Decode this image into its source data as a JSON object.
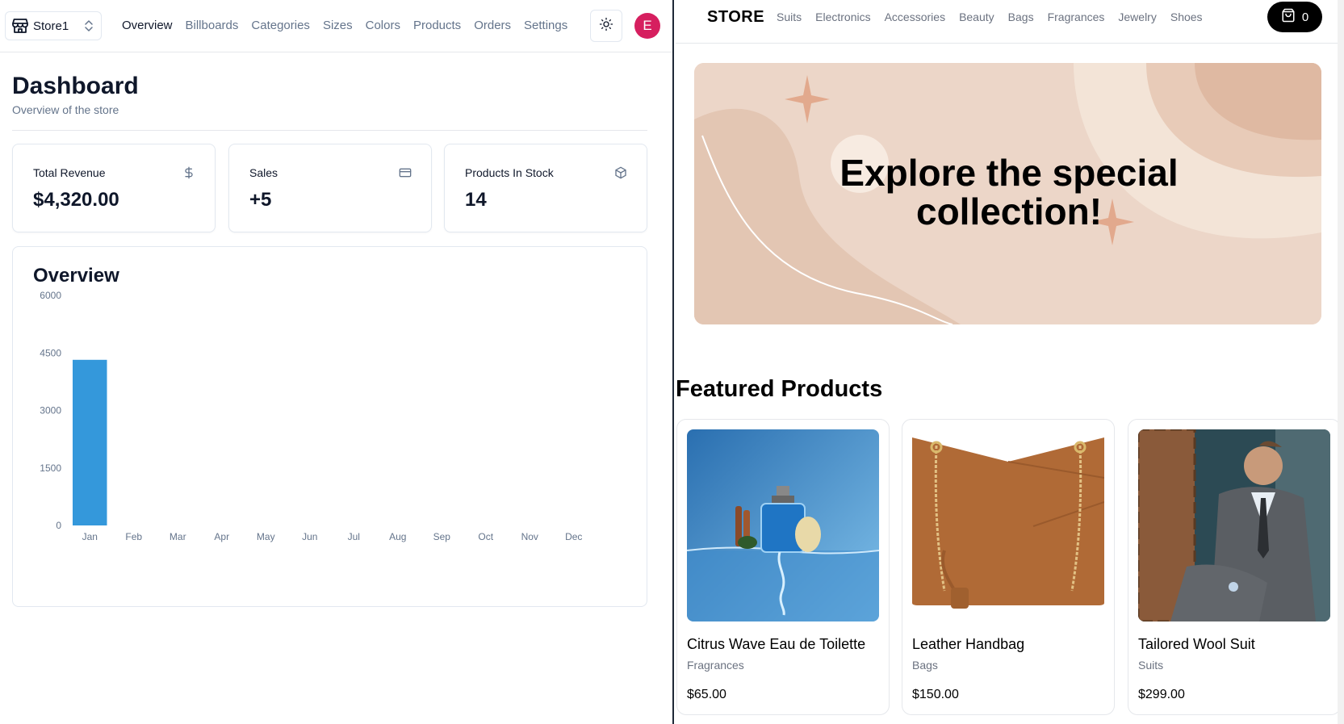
{
  "admin": {
    "store_switcher": {
      "label": "Store1"
    },
    "nav": [
      "Overview",
      "Billboards",
      "Categories",
      "Sizes",
      "Colors",
      "Products",
      "Orders",
      "Settings"
    ],
    "active_nav": "Overview",
    "avatar_initial": "E",
    "title": "Dashboard",
    "subtitle": "Overview of the store",
    "stats": [
      {
        "label": "Total Revenue",
        "value": "$4,320.00",
        "icon": "dollar-sign-icon"
      },
      {
        "label": "Sales",
        "value": "+5",
        "icon": "credit-card-icon"
      },
      {
        "label": "Products In Stock",
        "value": "14",
        "icon": "package-icon"
      }
    ],
    "overview_title": "Overview"
  },
  "chart_data": {
    "type": "bar",
    "title": "Overview",
    "categories": [
      "Jan",
      "Feb",
      "Mar",
      "Apr",
      "May",
      "Jun",
      "Jul",
      "Aug",
      "Sep",
      "Oct",
      "Nov",
      "Dec"
    ],
    "values": [
      4320,
      0,
      0,
      0,
      0,
      0,
      0,
      0,
      0,
      0,
      0,
      0
    ],
    "yticks": [
      0,
      1500,
      3000,
      4500,
      6000
    ],
    "ylim": [
      0,
      6000
    ],
    "bar_color": "#3498db",
    "grid": false
  },
  "store": {
    "logo": "STORE",
    "categories": [
      "Suits",
      "Electronics",
      "Accessories",
      "Beauty",
      "Bags",
      "Fragrances",
      "Jewelry",
      "Shoes"
    ],
    "cart_count": "0",
    "billboard": {
      "line1": "Explore the special",
      "line2": "collection!"
    },
    "featured_title": "Featured Products",
    "products": [
      {
        "name": "Citrus Wave Eau de Toilette",
        "category": "Fragrances",
        "price": "$65.00"
      },
      {
        "name": "Leather Handbag",
        "category": "Bags",
        "price": "$150.00"
      },
      {
        "name": "Tailored Wool Suit",
        "category": "Suits",
        "price": "$299.00"
      }
    ]
  },
  "colors": {
    "accent_avatar": "#d61f5f",
    "bar": "#3498db",
    "billboard_bg": "#ecd6c8"
  }
}
